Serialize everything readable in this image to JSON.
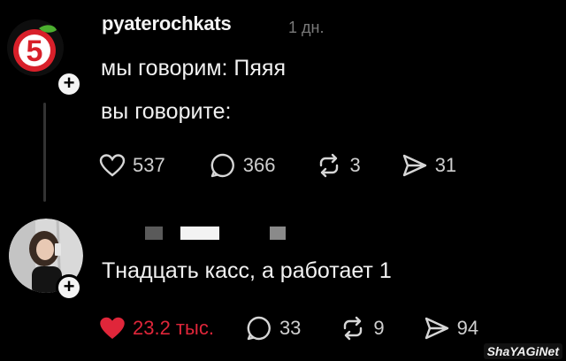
{
  "posts": [
    {
      "username": "pyaterochkats",
      "time": "1 дн.",
      "lines": [
        "мы говорим: Пяяя",
        "вы говорите:"
      ],
      "avatar_logo": "5",
      "stats": {
        "likes": "537",
        "comments": "366",
        "reposts": "3",
        "shares": "31"
      }
    },
    {
      "text": "Тнадцать касс, а работает 1",
      "stats": {
        "likes": "23.2 тыс.",
        "comments": "33",
        "reposts": "9",
        "shares": "94"
      }
    }
  ],
  "icons": {
    "like": "heart-icon",
    "liked": "heart-filled-icon",
    "comment": "comment-bubble-icon",
    "repost": "repost-icon",
    "share": "send-icon",
    "follow": "plus-icon"
  },
  "colors": {
    "liked": "#e0263a",
    "brand_red": "#d8202a",
    "brand_green": "#4caf2f"
  },
  "watermark": "ShaYAGiNet"
}
